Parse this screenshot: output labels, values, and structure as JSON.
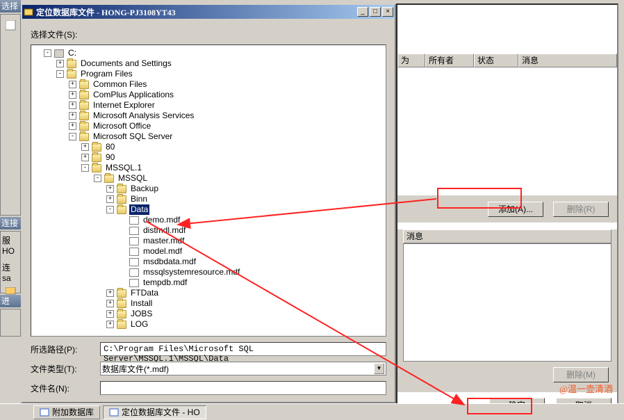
{
  "left_strip": {
    "h1": "选择",
    "h2": "连接",
    "l1": "服",
    "l2": "HO",
    "l3": "连",
    "l4": "sa",
    "h3": "进"
  },
  "dialog": {
    "title": "定位数据库文件 - HONG-PJ3108YT43",
    "select_label": "选择文件(S):",
    "path_label": "所选路径(P):",
    "path_value": "C:\\Program Files\\Microsoft SQL Server\\MSSQL.1\\MSSQL\\Data",
    "type_label": "文件类型(T):",
    "type_value": "数据库文件(*.mdf)",
    "name_label": "文件名(N):",
    "name_value": ""
  },
  "tree": {
    "root": "C:",
    "n0": "Documents and Settings",
    "n1": "Program Files",
    "n1_0": "Common Files",
    "n1_1": "ComPlus Applications",
    "n1_2": "Internet Explorer",
    "n1_3": "Microsoft Analysis Services",
    "n1_4": "Microsoft Office",
    "n1_5": "Microsoft SQL Server",
    "n1_5_0": "80",
    "n1_5_1": "90",
    "n1_5_2": "MSSQL.1",
    "n1_5_2_0": "MSSQL",
    "bk": "Backup",
    "bn": "Binn",
    "da": "Data",
    "f0": "demo.mdf",
    "f1": "distmdl.mdf",
    "f2": "master.mdf",
    "f3": "model.mdf",
    "f4": "msdbdata.mdf",
    "f5": "mssqlsystemresource.mdf",
    "f6": "tempdb.mdf",
    "ft": "FTData",
    "in": "Install",
    "jo": "JOBS",
    "lo": "LOG"
  },
  "right": {
    "col1": "为",
    "col2": "所有者",
    "col3": "状态",
    "col4": "消息",
    "add_btn": "添加(A)...",
    "del_btn": "删除(R)",
    "msg_header": "消息",
    "del2_btn": "删除(M)",
    "ok_btn": "确定",
    "cancel_btn": "取消"
  },
  "taskbar": {
    "t1": "附加数据库",
    "t2": "定位数据库文件 - HO"
  },
  "watermark": "@温一壶清酒"
}
